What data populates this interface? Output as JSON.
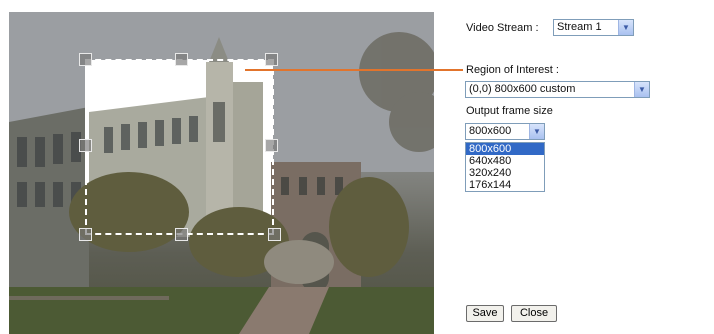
{
  "video_stream": {
    "label": "Video Stream :",
    "value": "Stream 1"
  },
  "roi": {
    "label": "Region of Interest :",
    "value": "(0,0) 800x600 custom"
  },
  "frame_size": {
    "label": "Output frame size",
    "value": "800x600",
    "options": [
      "800x600",
      "640x480",
      "320x240",
      "176x144"
    ],
    "selected_index": 0
  },
  "buttons": {
    "save": "Save",
    "close": "Close"
  },
  "colors": {
    "connector": "#e2742c",
    "list_highlight": "#3169c6"
  }
}
